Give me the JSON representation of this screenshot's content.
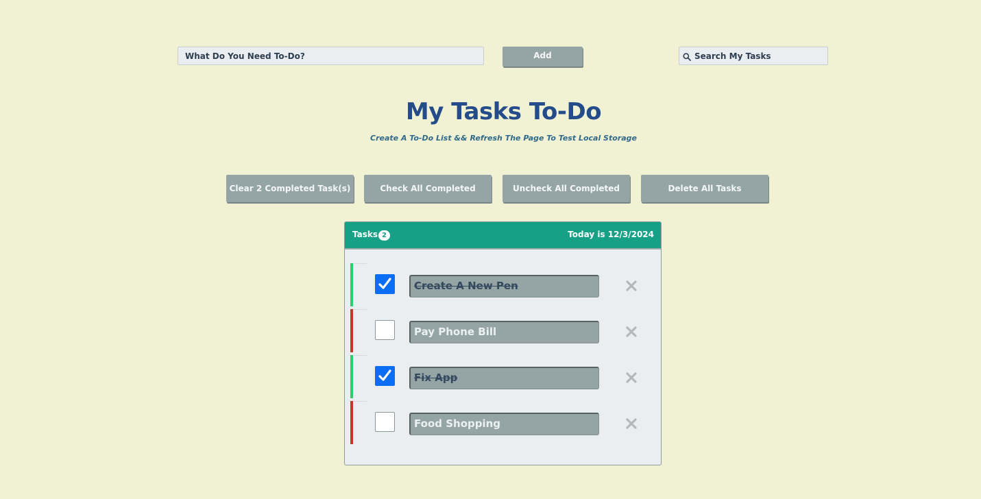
{
  "top_bar": {
    "task_input_placeholder": "What Do You Need To-Do?",
    "add_label": "Add",
    "search_placeholder": "Search My Tasks"
  },
  "header": {
    "title": "My Tasks To-Do",
    "subtitle": "Create A To-Do List && Refresh The Page To Test Local Storage"
  },
  "actions": {
    "clear_completed_label": "Clear 2 Completed Task(s)",
    "check_all_label": "Check All Completed",
    "uncheck_all_label": "Uncheck All Completed",
    "delete_all_label": "Delete All Tasks"
  },
  "panel": {
    "tasks_label": "Tasks",
    "task_count": "2",
    "date_text": "Today is 12/3/2024"
  },
  "tasks": [
    {
      "text": "Create A New Pen",
      "completed": true
    },
    {
      "text": "Pay Phone Bill",
      "completed": false
    },
    {
      "text": "Fix App",
      "completed": true
    },
    {
      "text": "Food Shopping",
      "completed": false
    }
  ],
  "colors": {
    "background": "#f1f2d4",
    "header_bg": "#16a085",
    "title": "#244b8a",
    "button_bg": "#95a5a6",
    "checkbox_checked": "#0a6ef5",
    "status_done": "#2ecc71",
    "status_todo": "#c0392b"
  },
  "icons": {
    "search": "search-icon",
    "delete": "close-icon",
    "check": "check-icon"
  }
}
